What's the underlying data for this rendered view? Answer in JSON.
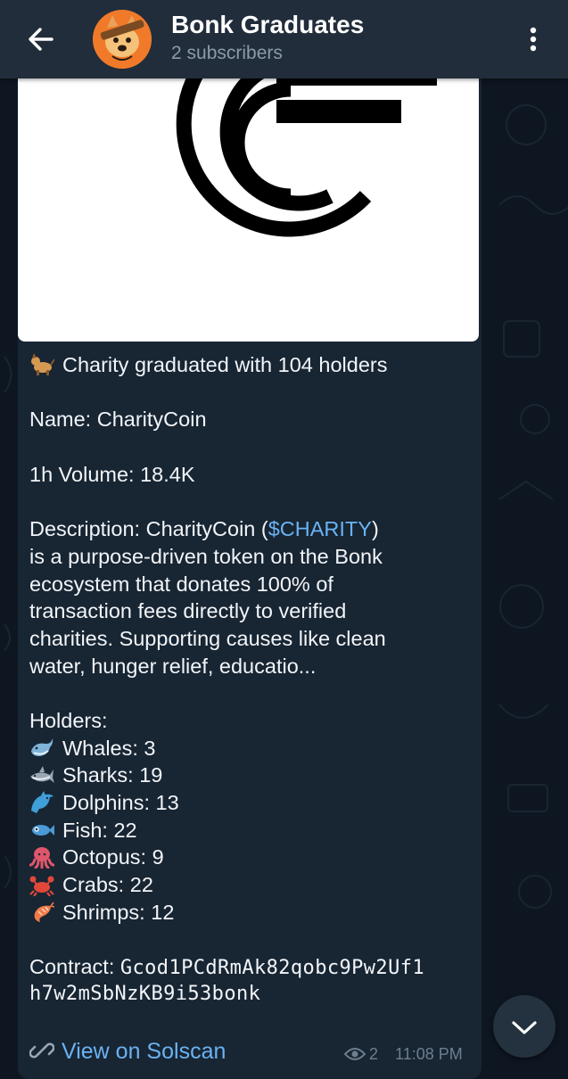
{
  "header": {
    "back_icon": "arrow-left-icon",
    "title": "Bonk Graduates",
    "subtitle": "2 subscribers",
    "menu_icon": "more-vertical-icon"
  },
  "message": {
    "headline": "Charity graduated with 104 holders",
    "headline_icon": "dog-emoji",
    "name_line": "Name: CharityCoin",
    "volume_line": "1h Volume: 18.4K",
    "description": {
      "prefix": "Description: CharityCoin (",
      "ticker": "$CHARITY",
      "suffix": ")",
      "lines": [
        "is a purpose-driven token on the Bonk",
        "ecosystem that donates 100% of",
        "transaction fees directly to verified",
        "charities. Supporting causes like clean",
        "water, hunger relief, educatio..."
      ]
    },
    "holders_label": "Holders:",
    "holders": [
      {
        "icon": "whale-emoji",
        "text": "Whales: 3"
      },
      {
        "icon": "shark-emoji",
        "text": "Sharks: 19"
      },
      {
        "icon": "dolphin-emoji",
        "text": "Dolphins: 13"
      },
      {
        "icon": "fish-emoji",
        "text": "Fish: 22"
      },
      {
        "icon": "octopus-emoji",
        "text": "Octopus: 9"
      },
      {
        "icon": "crab-emoji",
        "text": "Crabs: 22"
      },
      {
        "icon": "shrimp-emoji",
        "text": "Shrimps: 12"
      }
    ],
    "contract_label": "Contract: ",
    "contract_line1": "Gcod1PCdRmAk82qobc9Pw2Uf1",
    "contract_line2": "h7w2mSbNzKB9i53bonk",
    "link_label": "View on Solscan",
    "link_icon": "link-icon",
    "views": "2",
    "time": "11:08 PM"
  },
  "colors": {
    "background": "#0e1621",
    "header": "#212d3b",
    "bubble": "#182533",
    "link": "#6ab3f3",
    "meta": "#6d7f8f"
  }
}
